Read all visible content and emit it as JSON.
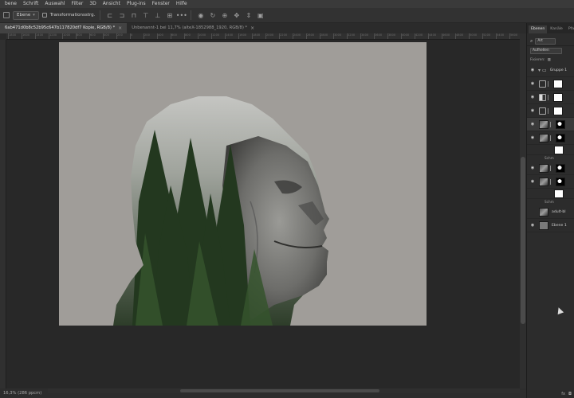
{
  "menu": [
    "bene",
    "Schrift",
    "Auswahl",
    "Filter",
    "3D",
    "Ansicht",
    "Plug-ins",
    "Fenster",
    "Hilfe"
  ],
  "options": {
    "sample_dropdown": "Ebene",
    "transform_label": "Transformationsstrg."
  },
  "tabs": [
    {
      "label": "6ab471d0b8c52b95c647b117820df7 Kopie, RGB/8) *",
      "active": true
    },
    {
      "label": "Unbenannt-1 bei 11,7% (alteX-1852988_1920, RGB/8) *",
      "active": false
    }
  ],
  "ruler_numbers": [
    "1800",
    "1600",
    "1400",
    "1200",
    "1000",
    "800",
    "600",
    "400",
    "200",
    "0",
    "200",
    "400",
    "600",
    "800",
    "1000",
    "1200",
    "1400",
    "1600",
    "1800",
    "2000",
    "2200",
    "2400",
    "2600",
    "2800",
    "3000",
    "3200",
    "3400",
    "3600",
    "3800",
    "4000",
    "4200",
    "4400",
    "4600",
    "4800",
    "5000",
    "5200",
    "5400",
    "5600"
  ],
  "status": {
    "zoom": "16,3% (286 ppcm)"
  },
  "panel": {
    "tabs": [
      "Ebenen",
      "Kanäle",
      "Pfade"
    ],
    "filter_label": "Art",
    "blend_mode": "Aufhellen",
    "lock_label": "Fixieren:",
    "layers": [
      {
        "name": "Gruppe 1",
        "kind": "group",
        "selected": false
      },
      {
        "name": "",
        "kind": "adj-levels",
        "selected": false
      },
      {
        "name": "",
        "kind": "adj-bw",
        "selected": false
      },
      {
        "name": "",
        "kind": "adj-curves",
        "selected": false
      },
      {
        "name": "",
        "kind": "photo-mask",
        "selected": true
      },
      {
        "name": "",
        "kind": "photo-mask2",
        "selected": false
      },
      {
        "name": "",
        "kind": "white",
        "selected": false
      },
      {
        "name": "Schm",
        "kind": "sub",
        "selected": false
      },
      {
        "name": "",
        "kind": "photo-mask3",
        "selected": false
      },
      {
        "name": "",
        "kind": "photo-mask4",
        "selected": false
      },
      {
        "name": "",
        "kind": "white2",
        "selected": false
      },
      {
        "name": "Schm",
        "kind": "sub",
        "selected": false
      },
      {
        "name": "adult-bl",
        "kind": "photo",
        "selected": false
      },
      {
        "name": "Ebene 1",
        "kind": "fill",
        "selected": false
      }
    ]
  },
  "colors": {
    "canvas_bg": "#a09d99",
    "forest": "#2f4a2a",
    "face": "#8a8a86"
  }
}
